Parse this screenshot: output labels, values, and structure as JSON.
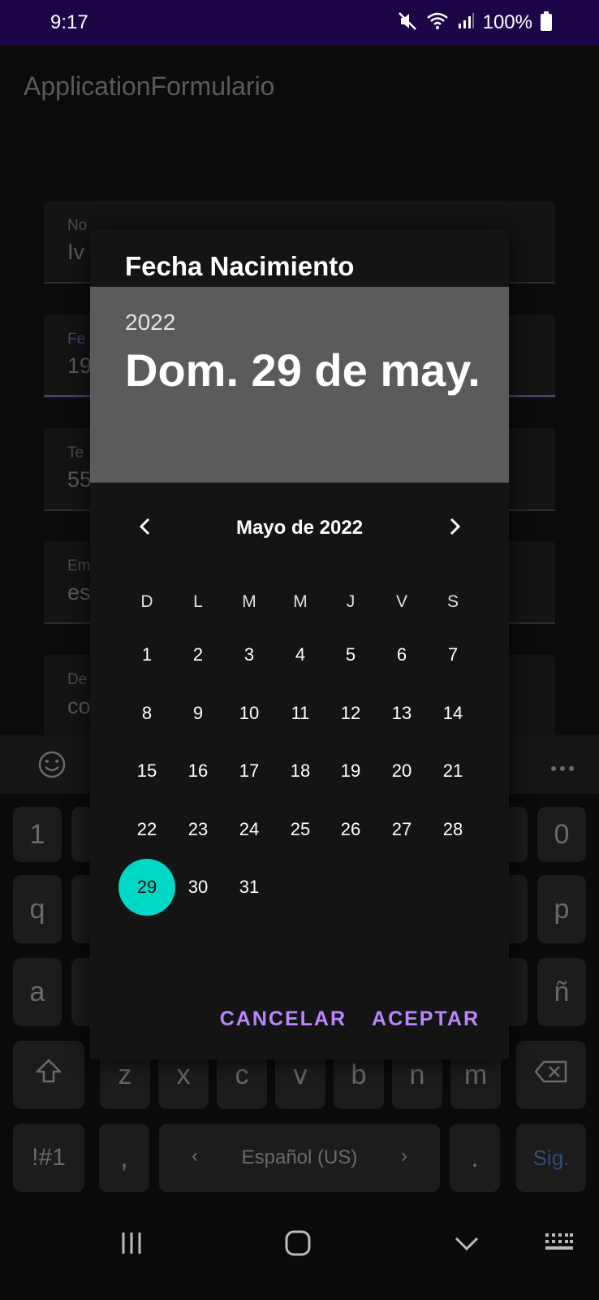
{
  "status_bar": {
    "time": "9:17",
    "battery": "100%"
  },
  "app": {
    "title": "ApplicationFormulario",
    "fields": [
      {
        "label": "No",
        "value": "Iv"
      },
      {
        "label": "Fe",
        "value": "19"
      },
      {
        "label": "Te",
        "value": "55"
      },
      {
        "label": "Em",
        "value": "es"
      },
      {
        "label": "De",
        "value": "co"
      }
    ]
  },
  "dialog": {
    "title": "Fecha Nacimiento",
    "year": "2022",
    "selected_date": "Dom. 29 de may.",
    "month_label": "Mayo de 2022",
    "weekdays": [
      "D",
      "L",
      "M",
      "M",
      "J",
      "V",
      "S"
    ],
    "days": [
      "1",
      "2",
      "3",
      "4",
      "5",
      "6",
      "7",
      "8",
      "9",
      "10",
      "11",
      "12",
      "13",
      "14",
      "15",
      "16",
      "17",
      "18",
      "19",
      "20",
      "21",
      "22",
      "23",
      "24",
      "25",
      "26",
      "27",
      "28",
      "29",
      "30",
      "31"
    ],
    "selected_day": "29",
    "cancel_label": "CANCELAR",
    "ok_label": "ACEPTAR",
    "accent_color": "#bb86fc",
    "selected_color": "#00d8c6"
  },
  "keyboard": {
    "row_numbers": [
      "1",
      "",
      "",
      "",
      "",
      "",
      "",
      "",
      "",
      "0"
    ],
    "left_keys": [
      "1",
      "q",
      "a"
    ],
    "right_keys": [
      "0",
      "p",
      "ñ"
    ],
    "row_z": [
      "z",
      "x",
      "c",
      "v",
      "b",
      "n",
      "m"
    ],
    "sym_label": "!#1",
    "comma": ",",
    "space_label": "Español (US)",
    "period": ".",
    "go_label": "Sig."
  }
}
